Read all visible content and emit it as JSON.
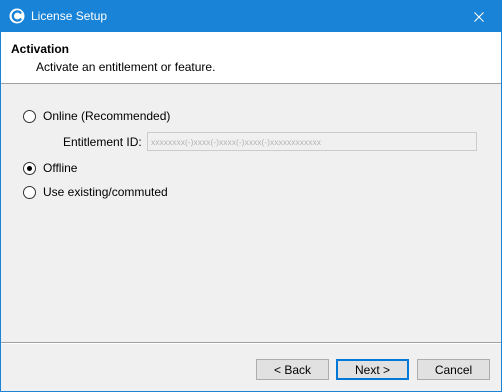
{
  "window": {
    "title": "License Setup",
    "app_icon": "app-logo-icon",
    "close_icon": "close-icon"
  },
  "header": {
    "title": "Activation",
    "description": "Activate an entitlement or feature."
  },
  "options": {
    "online_label": "Online (Recommended)",
    "offline_label": "Offline",
    "existing_label": "Use existing/commuted",
    "selected": "offline"
  },
  "entitlement": {
    "label": "Entitlement ID:",
    "value": "",
    "placeholder": "xxxxxxxx(-)xxxx(-)xxxx(-)xxxx(-)xxxxxxxxxxxx",
    "enabled": false
  },
  "buttons": {
    "back_label": "< Back",
    "next_label": "Next >",
    "cancel_label": "Cancel"
  },
  "colors": {
    "titlebar": "#1883d7",
    "accent": "#0078d7"
  }
}
